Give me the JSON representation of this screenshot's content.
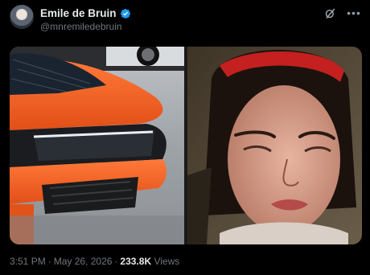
{
  "author": {
    "display_name": "Emile de Bruin",
    "handle": "@mnremiledebruin"
  },
  "icons": {
    "avatar": "avatar-image",
    "verified": "verified-badge-icon",
    "grok": "grok-icon",
    "more": "more-options-icon"
  },
  "post": {
    "time": "3:51 PM",
    "separator": "·",
    "date": "May 26, 2026",
    "views_count": "233.8K",
    "views_label": "Views"
  },
  "colors": {
    "background": "#000000",
    "verified": "#1d9bf0",
    "muted_text": "#71767b"
  },
  "media": {
    "left": "orange-sports-car-front-photo",
    "right": "woman-with-red-headband-portrait-photo"
  }
}
